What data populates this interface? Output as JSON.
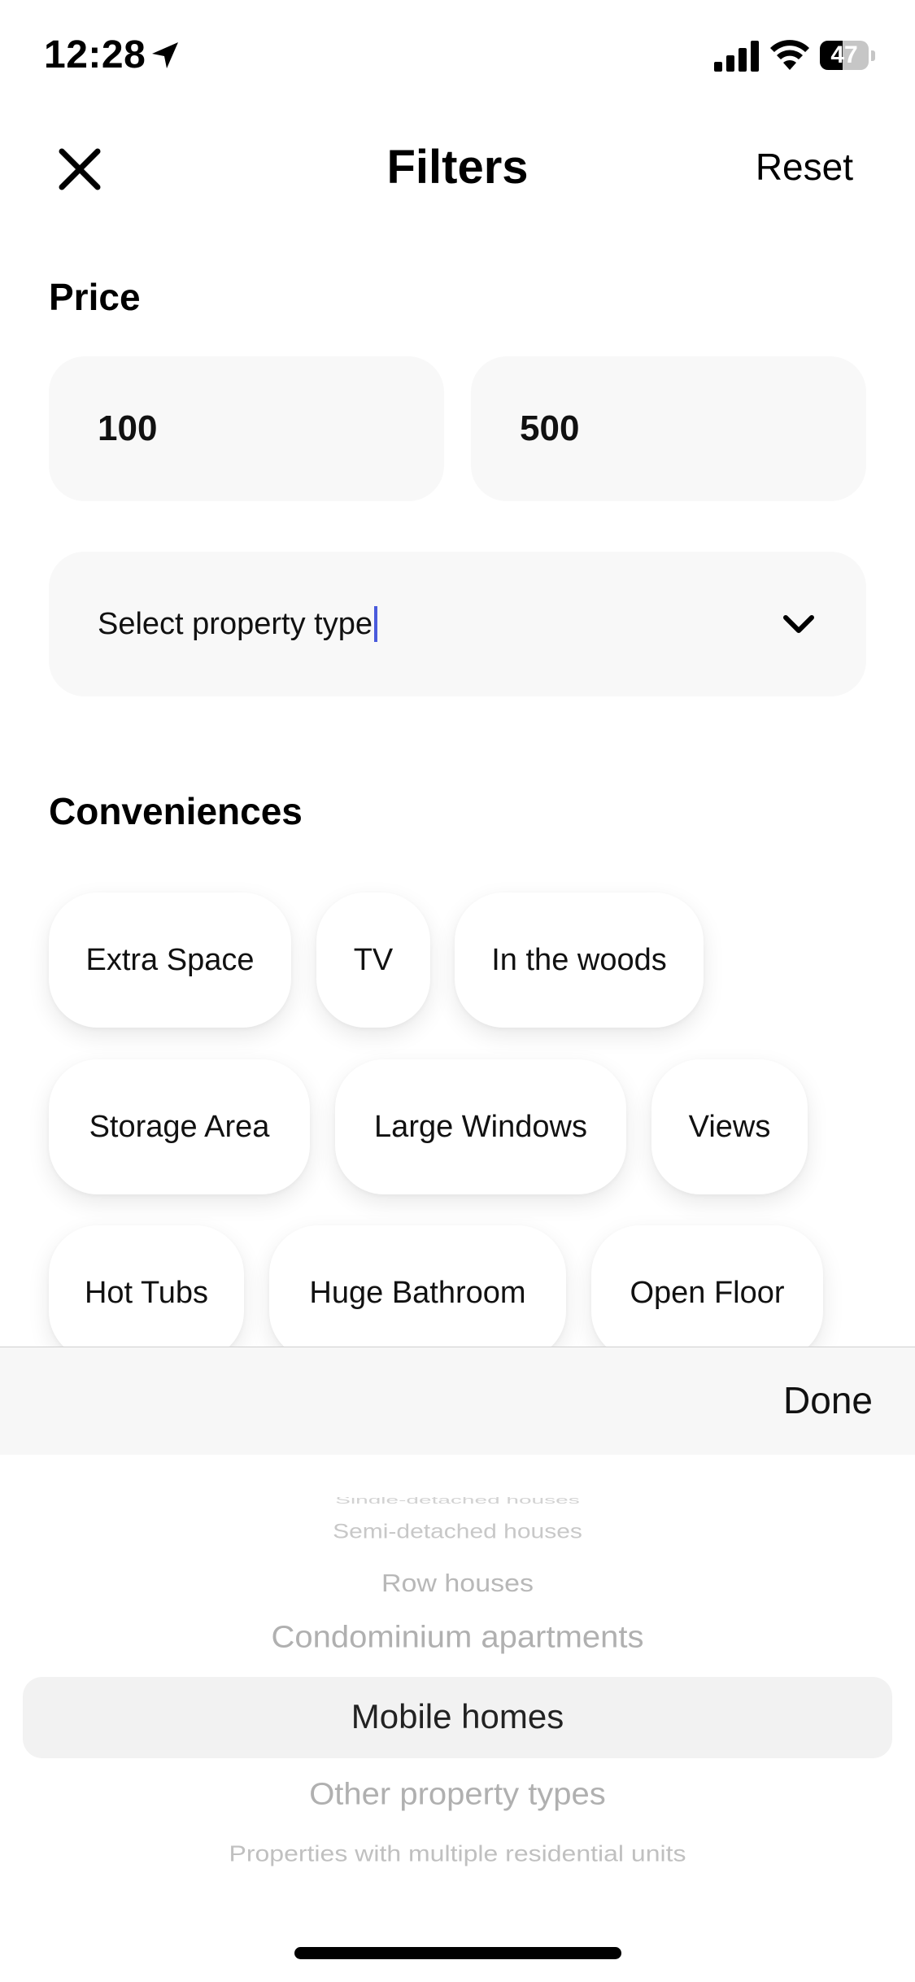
{
  "status_bar": {
    "time": "12:28",
    "battery": "47",
    "battery_level": 0.47
  },
  "header": {
    "title": "Filters",
    "reset_label": "Reset"
  },
  "price": {
    "title": "Price",
    "min_value": "100",
    "max_value": "500"
  },
  "property_type": {
    "placeholder": "Select property type"
  },
  "conveniences": {
    "title": "Conveniences",
    "chips": [
      "Extra Space",
      "TV",
      "In the woods",
      "Storage Area",
      "Large Windows",
      "Views",
      "Hot Tubs",
      "Huge Bathroom",
      "Open Floor"
    ]
  },
  "picker": {
    "done_label": "Done",
    "options": [
      "Single-detached houses",
      "Semi-detached houses",
      "Row houses",
      "Condominium apartments",
      "Mobile homes",
      "Other property types",
      "Properties with multiple residential units"
    ],
    "selected": "Mobile homes"
  }
}
